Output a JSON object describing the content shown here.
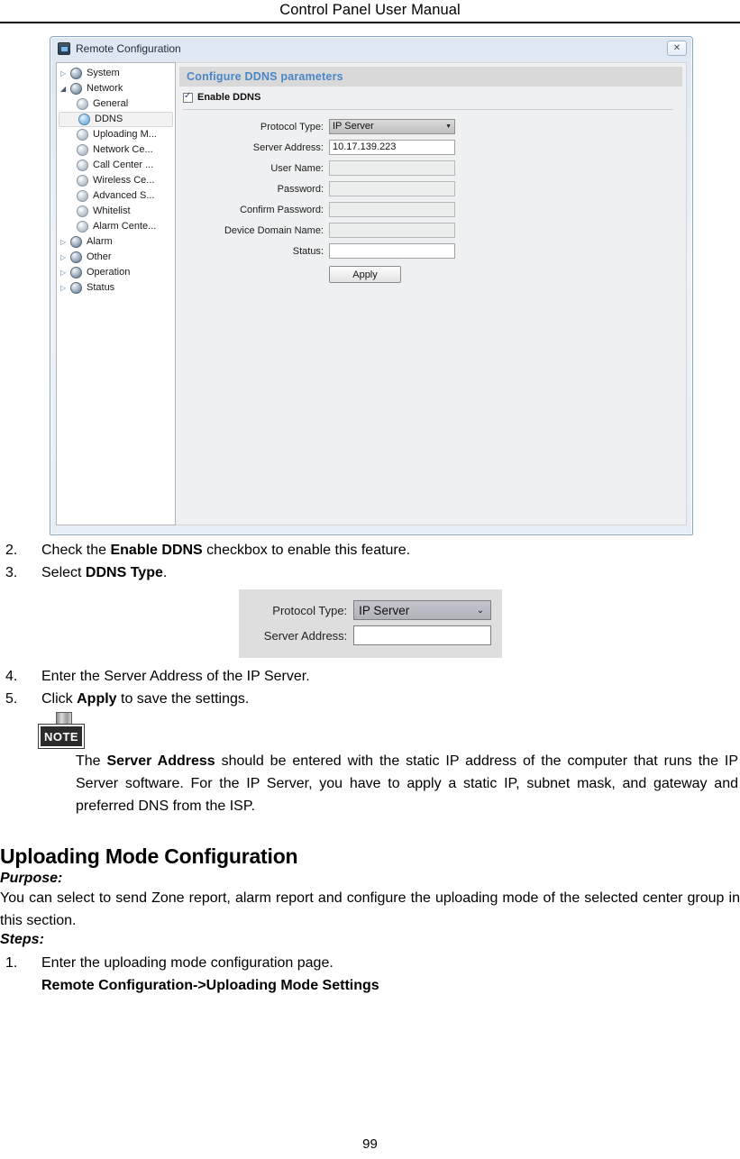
{
  "page": {
    "header_title": "Control Panel User Manual",
    "page_number": "99"
  },
  "dialog": {
    "title": "Remote Configuration",
    "close_label": "✕",
    "tree": [
      {
        "label": "System",
        "level": 1,
        "arrow": "▷",
        "icon": "globe-gear-icon",
        "selected": false,
        "expanded": false
      },
      {
        "label": "Network",
        "level": 1,
        "arrow": "◢",
        "icon": "globe-gear-icon",
        "selected": false,
        "expanded": true
      },
      {
        "label": "General",
        "level": 2,
        "arrow": "",
        "icon": "gear-icon",
        "selected": false,
        "expanded": false
      },
      {
        "label": "DDNS",
        "level": 2,
        "arrow": "",
        "icon": "gear-icon-active",
        "selected": true,
        "expanded": false
      },
      {
        "label": "Uploading M...",
        "level": 2,
        "arrow": "",
        "icon": "gear-icon",
        "selected": false,
        "expanded": false
      },
      {
        "label": "Network Ce...",
        "level": 2,
        "arrow": "",
        "icon": "gear-icon",
        "selected": false,
        "expanded": false
      },
      {
        "label": "Call Center ...",
        "level": 2,
        "arrow": "",
        "icon": "gear-icon",
        "selected": false,
        "expanded": false
      },
      {
        "label": "Wireless Ce...",
        "level": 2,
        "arrow": "",
        "icon": "gear-icon",
        "selected": false,
        "expanded": false
      },
      {
        "label": "Advanced S...",
        "level": 2,
        "arrow": "",
        "icon": "gear-icon",
        "selected": false,
        "expanded": false
      },
      {
        "label": "Whitelist",
        "level": 2,
        "arrow": "",
        "icon": "gear-icon",
        "selected": false,
        "expanded": false
      },
      {
        "label": "Alarm Cente...",
        "level": 2,
        "arrow": "",
        "icon": "gear-icon",
        "selected": false,
        "expanded": false
      },
      {
        "label": "Alarm",
        "level": 1,
        "arrow": "▷",
        "icon": "globe-gear-icon",
        "selected": false,
        "expanded": false
      },
      {
        "label": "Other",
        "level": 1,
        "arrow": "▷",
        "icon": "globe-gear-icon",
        "selected": false,
        "expanded": false
      },
      {
        "label": "Operation",
        "level": 1,
        "arrow": "▷",
        "icon": "globe-gear-icon",
        "selected": false,
        "expanded": false
      },
      {
        "label": "Status",
        "level": 1,
        "arrow": "▷",
        "icon": "globe-gear-icon",
        "selected": false,
        "expanded": false
      }
    ],
    "panel": {
      "section_title": "Configure DDNS parameters",
      "enable_checkbox_label": "Enable DDNS",
      "enable_checkbox_checked": true,
      "fields": [
        {
          "label": "Protocol Type:",
          "type": "select",
          "value": "IP Server",
          "disabled": false
        },
        {
          "label": "Server Address:",
          "type": "text",
          "value": "10.17.139.223",
          "disabled": false
        },
        {
          "label": "User Name:",
          "type": "text",
          "value": "",
          "disabled": true
        },
        {
          "label": "Password:",
          "type": "text",
          "value": "",
          "disabled": true
        },
        {
          "label": "Confirm Password:",
          "type": "text",
          "value": "",
          "disabled": true
        },
        {
          "label": "Device Domain Name:",
          "type": "text",
          "value": "",
          "disabled": true
        },
        {
          "label": "Status:",
          "type": "text",
          "value": "",
          "disabled": false
        }
      ],
      "apply_label": "Apply",
      "accent_color": "#4a86c8",
      "caret_glyph": "▼"
    }
  },
  "steps": {
    "item2_num": "2.",
    "item2_a": "Check the ",
    "item2_b": "Enable DDNS",
    "item2_c": " checkbox to enable this feature.",
    "item3_num": "3.",
    "item3_a": "Select ",
    "item3_b": "DDNS Type",
    "item3_c": ".",
    "item4_num": "4.",
    "item4_text": "Enter the Server Address of the IP Server.",
    "item5_num": "5.",
    "item5_a": "Click ",
    "item5_b": "Apply",
    "item5_c": " to save the settings."
  },
  "mini_shot": {
    "protocol_label": "Protocol Type:",
    "protocol_value": "IP Server",
    "server_label": "Server Address:",
    "server_value": "",
    "caret_glyph": "⌄"
  },
  "note": {
    "icon_label": "NOTE",
    "text_a": "The ",
    "text_b": "Server Address",
    "text_c": " should be entered with the static IP address of the computer that runs the IP Server software. For the IP Server, you have to apply a static IP, subnet mask, and gateway and preferred DNS from the ISP."
  },
  "section": {
    "heading": "Uploading Mode Configuration",
    "purpose_label": "Purpose:",
    "purpose_text": "You can select to send Zone report, alarm report and configure the uploading mode of the selected center group in this section.",
    "steps_label": "Steps:",
    "step1_num": "1.",
    "step1_text": "Enter the uploading mode configuration page.",
    "step1_path": "Remote Configuration->Uploading Mode Settings"
  }
}
